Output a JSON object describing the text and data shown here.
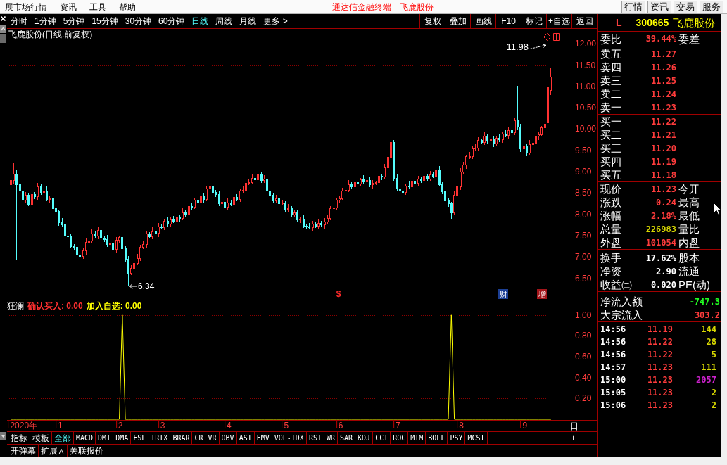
{
  "menu_bar": {
    "menus": [
      "展市场行情",
      "资讯",
      "工具",
      "帮助"
    ],
    "title": "通达信金融终端",
    "stock_name": "飞鹿股份",
    "buttons": [
      "行情",
      "资讯",
      "交易",
      "服务"
    ]
  },
  "period_tabs": [
    {
      "label": "分时",
      "selected": false
    },
    {
      "label": "1分钟",
      "selected": false
    },
    {
      "label": "5分钟",
      "selected": false
    },
    {
      "label": "15分钟",
      "selected": false
    },
    {
      "label": "30分钟",
      "selected": false
    },
    {
      "label": "60分钟",
      "selected": false
    },
    {
      "label": "日线",
      "selected": true
    },
    {
      "label": "周线",
      "selected": false
    },
    {
      "label": "月线",
      "selected": false
    },
    {
      "label": "更多 >",
      "selected": false
    }
  ],
  "toolbar_buttons": [
    "复权",
    "叠加",
    "画线",
    "F10",
    "标记",
    "+自选",
    "返回"
  ],
  "price_chart": {
    "title": "飞鹿股份(日线.前复权)",
    "high_label": "11.98",
    "low_label": "6.34",
    "event_marks": [
      {
        "label": "$",
        "kind": "symbol",
        "color": "#ff2a2a"
      },
      {
        "label": "财",
        "kind": "tag",
        "color": "#1c3f94"
      },
      {
        "label": "增",
        "kind": "tag",
        "color": "#a3151a"
      }
    ],
    "chart_data": {
      "type": "candlestick",
      "ylim": [
        6.0,
        12.35
      ],
      "grid": true,
      "yticks": [
        {
          "value": 12,
          "label": "12.00"
        },
        {
          "value": 11.5,
          "label": "11.50"
        },
        {
          "value": 11,
          "label": "11.00"
        },
        {
          "value": 10.5,
          "label": "10.50"
        },
        {
          "value": 10,
          "label": "10.00"
        },
        {
          "value": 9.5,
          "label": "9.50"
        },
        {
          "value": 9,
          "label": "9.00"
        },
        {
          "value": 8.5,
          "label": "8.50"
        },
        {
          "value": 8,
          "label": "8.00"
        },
        {
          "value": 7.5,
          "label": "7.50"
        },
        {
          "value": 7,
          "label": "7.00"
        },
        {
          "value": 6.5,
          "label": "6.50"
        }
      ],
      "categories": [
        null,
        null,
        null,
        null,
        null,
        null,
        null,
        null,
        null,
        null,
        null,
        null,
        null,
        null,
        null,
        null,
        null,
        null,
        null,
        null,
        null,
        null,
        null,
        null,
        null,
        null,
        null,
        null,
        null,
        null,
        null,
        null,
        null,
        null,
        null,
        null,
        null,
        null,
        null,
        null,
        null,
        null,
        null,
        null,
        null,
        null,
        null,
        null,
        null,
        null,
        null,
        null,
        null,
        null,
        null,
        null,
        null,
        null,
        null,
        null,
        null,
        null,
        null,
        null,
        null,
        null,
        null,
        null,
        null,
        null,
        null,
        null,
        null,
        null,
        null,
        null,
        null,
        null,
        null,
        null,
        null,
        null,
        null,
        null,
        null,
        null,
        null,
        null,
        null,
        null,
        null,
        null,
        null,
        null,
        null,
        null,
        null,
        null,
        null,
        null,
        null,
        null,
        null,
        null,
        null,
        null,
        null,
        null,
        null,
        null,
        null,
        null,
        null,
        null,
        null,
        null,
        null,
        null,
        null,
        null,
        null,
        null,
        null,
        null,
        null,
        null,
        null,
        null,
        null,
        null,
        null,
        null,
        null,
        null,
        null,
        null,
        null,
        null,
        null,
        null,
        null,
        null,
        null,
        null,
        null,
        null,
        null,
        null,
        null,
        null,
        null,
        null,
        null,
        null,
        null,
        null,
        null,
        null,
        null,
        null,
        null,
        null,
        null,
        null,
        null,
        null,
        null,
        null,
        null,
        null,
        null,
        null,
        null,
        null,
        null,
        null,
        null,
        null,
        null,
        null
      ],
      "ohlc": [
        [
          8.7,
          8.86,
          8.65,
          8.8
        ],
        [
          8.8,
          9.2,
          8.72,
          8.95
        ],
        [
          8.95,
          9.04,
          6.95,
          8.7
        ],
        [
          8.7,
          8.74,
          8.49,
          8.55
        ],
        [
          8.55,
          8.62,
          8.3,
          8.35
        ],
        [
          8.35,
          8.51,
          8.27,
          8.45
        ],
        [
          8.45,
          8.48,
          8.22,
          8.25
        ],
        [
          8.25,
          8.57,
          8.19,
          8.48
        ],
        [
          8.48,
          8.52,
          8.37,
          8.42
        ],
        [
          8.42,
          8.73,
          8.34,
          8.66
        ],
        [
          8.66,
          8.72,
          8.47,
          8.5
        ],
        [
          8.5,
          8.58,
          8.44,
          8.55
        ],
        [
          8.55,
          8.64,
          8.31,
          8.36
        ],
        [
          8.36,
          8.42,
          8.28,
          8.38
        ],
        [
          8.38,
          8.45,
          8.12,
          8.15
        ],
        [
          8.15,
          8.21,
          8.02,
          8.08
        ],
        [
          8.08,
          8.11,
          7.74,
          7.82
        ],
        [
          7.82,
          7.91,
          7.73,
          7.76
        ],
        [
          7.76,
          7.8,
          7.44,
          7.5
        ],
        [
          7.5,
          7.57,
          7.43,
          7.48
        ],
        [
          7.48,
          7.54,
          7.21,
          7.26
        ],
        [
          7.26,
          7.29,
          7.16,
          7.24
        ],
        [
          7.24,
          7.33,
          7.02,
          7.05
        ],
        [
          7.05,
          7.09,
          6.96,
          7.02
        ],
        [
          7.02,
          7.22,
          6.97,
          7.15
        ],
        [
          7.15,
          7.42,
          7.07,
          7.36
        ],
        [
          7.36,
          7.41,
          7.33,
          7.38
        ],
        [
          7.38,
          7.64,
          7.32,
          7.55
        ],
        [
          7.55,
          7.59,
          7.45,
          7.5
        ],
        [
          7.5,
          7.71,
          7.42,
          7.64
        ],
        [
          7.64,
          7.7,
          7.42,
          7.45
        ],
        [
          7.45,
          7.48,
          7.36,
          7.42
        ],
        [
          7.42,
          7.51,
          7.25,
          7.3
        ],
        [
          7.3,
          7.36,
          7.22,
          7.32
        ],
        [
          7.32,
          7.39,
          7.15,
          7.18
        ],
        [
          7.18,
          7.46,
          7.12,
          7.4
        ],
        [
          7.4,
          7.49,
          7.35,
          7.46
        ],
        [
          7.46,
          7.55,
          7.14,
          7.2
        ],
        [
          7.2,
          7.24,
          6.9,
          6.95
        ],
        [
          6.95,
          7.02,
          6.34,
          6.62
        ],
        [
          6.62,
          6.81,
          6.59,
          6.75
        ],
        [
          6.75,
          6.89,
          6.67,
          6.86
        ],
        [
          6.86,
          7.07,
          6.83,
          6.98
        ],
        [
          6.98,
          7.28,
          6.92,
          7.24
        ],
        [
          7.24,
          7.37,
          7.19,
          7.3
        ],
        [
          7.3,
          7.61,
          7.22,
          7.55
        ],
        [
          7.55,
          7.58,
          7.45,
          7.48
        ],
        [
          7.48,
          7.69,
          7.42,
          7.6
        ],
        [
          7.6,
          7.64,
          7.51,
          7.56
        ],
        [
          7.56,
          7.79,
          7.48,
          7.72
        ],
        [
          7.72,
          7.78,
          7.67,
          7.7
        ],
        [
          7.7,
          7.87,
          7.64,
          7.84
        ],
        [
          7.84,
          7.93,
          7.73,
          7.78
        ],
        [
          7.78,
          7.92,
          7.7,
          7.88
        ],
        [
          7.88,
          7.95,
          7.82,
          7.85
        ],
        [
          7.85,
          8.01,
          7.79,
          7.95
        ],
        [
          7.95,
          7.98,
          7.84,
          7.92
        ],
        [
          7.92,
          8.14,
          7.89,
          8.05
        ],
        [
          8.05,
          8.09,
          7.96,
          8.02
        ],
        [
          8.02,
          8.27,
          7.97,
          8.2
        ],
        [
          8.2,
          8.26,
          8.1,
          8.18
        ],
        [
          8.18,
          8.38,
          8.15,
          8.35
        ],
        [
          8.35,
          8.44,
          8.22,
          8.28
        ],
        [
          8.28,
          8.46,
          8.23,
          8.42
        ],
        [
          8.42,
          8.49,
          8.28,
          8.36
        ],
        [
          8.36,
          8.66,
          8.31,
          8.6
        ],
        [
          8.6,
          8.95,
          8.52,
          8.66
        ],
        [
          8.66,
          8.75,
          8.49,
          8.52
        ],
        [
          8.52,
          8.56,
          8.42,
          8.48
        ],
        [
          8.48,
          8.55,
          8.21,
          8.26
        ],
        [
          8.26,
          8.36,
          8.18,
          8.3
        ],
        [
          8.3,
          8.33,
          8.14,
          8.17
        ],
        [
          8.17,
          8.37,
          8.11,
          8.28
        ],
        [
          8.28,
          8.32,
          8.2,
          8.25
        ],
        [
          8.25,
          8.47,
          8.17,
          8.4
        ],
        [
          8.4,
          8.46,
          8.33,
          8.36
        ],
        [
          8.36,
          8.58,
          8.3,
          8.55
        ],
        [
          8.55,
          8.66,
          8.5,
          8.57
        ],
        [
          8.57,
          8.78,
          8.54,
          8.74
        ],
        [
          8.74,
          8.83,
          8.69,
          8.76
        ],
        [
          8.76,
          8.92,
          8.71,
          8.86
        ],
        [
          8.86,
          8.89,
          8.74,
          8.82
        ],
        [
          8.82,
          9.1,
          8.79,
          8.94
        ],
        [
          8.94,
          8.98,
          8.74,
          8.8
        ],
        [
          8.8,
          8.91,
          8.75,
          8.84
        ],
        [
          8.84,
          8.87,
          8.48,
          8.56
        ],
        [
          8.56,
          8.65,
          8.42,
          8.45
        ],
        [
          8.45,
          8.49,
          8.27,
          8.33
        ],
        [
          8.33,
          8.45,
          8.28,
          8.38
        ],
        [
          8.38,
          8.41,
          8.18,
          8.26
        ],
        [
          8.26,
          8.33,
          8.23,
          8.27
        ],
        [
          8.27,
          8.3,
          8.07,
          8.13
        ],
        [
          8.13,
          8.23,
          8.05,
          8.14
        ],
        [
          8.14,
          8.18,
          7.97,
          8.0
        ],
        [
          8.0,
          8.11,
          7.95,
          8.04
        ],
        [
          8.04,
          8.1,
          7.83,
          7.88
        ],
        [
          7.88,
          7.93,
          7.8,
          7.9
        ],
        [
          7.9,
          7.99,
          7.71,
          7.74
        ],
        [
          7.74,
          7.78,
          7.66,
          7.72
        ],
        [
          7.72,
          7.79,
          7.65,
          7.7
        ],
        [
          7.7,
          7.84,
          7.62,
          7.78
        ],
        [
          7.78,
          7.81,
          7.7,
          7.73
        ],
        [
          7.73,
          7.89,
          7.67,
          7.8
        ],
        [
          7.8,
          7.84,
          7.71,
          7.76
        ],
        [
          7.76,
          7.9,
          7.68,
          7.83
        ],
        [
          7.83,
          7.98,
          7.8,
          7.92
        ],
        [
          7.92,
          8.18,
          7.89,
          8.15
        ],
        [
          8.15,
          8.25,
          8.09,
          8.16
        ],
        [
          8.16,
          8.38,
          8.11,
          8.34
        ],
        [
          8.34,
          8.44,
          8.29,
          8.37
        ],
        [
          8.37,
          8.61,
          8.34,
          8.55
        ],
        [
          8.55,
          8.6,
          8.47,
          8.57
        ],
        [
          8.57,
          8.79,
          8.54,
          8.7
        ],
        [
          8.7,
          8.74,
          8.6,
          8.66
        ],
        [
          8.66,
          8.83,
          8.61,
          8.76
        ],
        [
          8.76,
          8.82,
          8.64,
          8.72
        ],
        [
          8.72,
          8.85,
          8.69,
          8.82
        ],
        [
          8.82,
          8.91,
          8.71,
          8.77
        ],
        [
          8.77,
          8.84,
          8.72,
          8.8
        ],
        [
          8.8,
          8.87,
          8.65,
          8.7
        ],
        [
          8.7,
          8.8,
          8.62,
          8.74
        ],
        [
          8.74,
          8.78,
          8.71,
          8.75
        ],
        [
          8.75,
          8.99,
          8.72,
          8.9
        ],
        [
          8.9,
          8.94,
          8.82,
          8.88
        ],
        [
          8.88,
          9.17,
          8.83,
          9.1
        ],
        [
          9.1,
          9.41,
          9.02,
          9.35
        ],
        [
          9.35,
          10.02,
          9.32,
          9.7
        ],
        [
          9.7,
          9.74,
          8.79,
          8.85
        ],
        [
          8.85,
          8.94,
          8.55,
          8.6
        ],
        [
          8.6,
          8.63,
          8.47,
          8.55
        ],
        [
          8.55,
          8.61,
          8.49,
          8.52
        ],
        [
          8.52,
          8.71,
          8.46,
          8.68
        ],
        [
          8.68,
          8.77,
          8.61,
          8.66
        ],
        [
          8.66,
          8.82,
          8.58,
          8.78
        ],
        [
          8.78,
          8.85,
          8.7,
          8.73
        ],
        [
          8.73,
          8.9,
          8.67,
          8.84
        ],
        [
          8.84,
          8.87,
          8.74,
          8.79
        ],
        [
          8.79,
          8.99,
          8.71,
          8.9
        ],
        [
          8.9,
          8.94,
          8.81,
          8.84
        ],
        [
          8.84,
          9.01,
          8.78,
          8.94
        ],
        [
          8.94,
          9.0,
          8.86,
          8.91
        ],
        [
          8.91,
          9.07,
          8.83,
          9.04
        ],
        [
          9.04,
          9.13,
          8.67,
          8.7
        ],
        [
          8.7,
          8.74,
          8.48,
          8.54
        ],
        [
          8.54,
          8.61,
          8.27,
          8.32
        ],
        [
          8.32,
          8.38,
          8.18,
          8.26
        ],
        [
          8.26,
          8.29,
          7.9,
          8.05
        ],
        [
          8.05,
          8.54,
          8.02,
          8.45
        ],
        [
          8.45,
          8.7,
          8.39,
          8.66
        ],
        [
          8.66,
          9.07,
          8.58,
          9.0
        ],
        [
          9.0,
          9.22,
          8.95,
          9.16
        ],
        [
          9.16,
          9.39,
          9.08,
          9.36
        ],
        [
          9.36,
          9.46,
          9.33,
          9.37
        ],
        [
          9.37,
          9.59,
          9.31,
          9.55
        ],
        [
          9.55,
          9.64,
          9.5,
          9.57
        ],
        [
          9.57,
          9.8,
          9.49,
          9.74
        ],
        [
          9.74,
          9.77,
          9.67,
          9.7
        ],
        [
          9.7,
          9.93,
          9.64,
          9.84
        ],
        [
          9.84,
          9.88,
          9.67,
          9.73
        ],
        [
          9.73,
          9.85,
          9.68,
          9.78
        ],
        [
          9.78,
          9.84,
          9.58,
          9.66
        ],
        [
          9.66,
          9.83,
          9.63,
          9.8
        ],
        [
          9.8,
          9.89,
          9.7,
          9.76
        ],
        [
          9.76,
          9.94,
          9.68,
          9.9
        ],
        [
          9.9,
          9.97,
          9.81,
          9.86
        ],
        [
          9.86,
          10.03,
          9.78,
          9.97
        ],
        [
          9.97,
          10.0,
          9.9,
          9.93
        ],
        [
          9.93,
          10.24,
          9.87,
          10.2
        ],
        [
          10.2,
          11.0,
          9.98,
          10.05
        ],
        [
          10.05,
          10.12,
          9.47,
          9.55
        ],
        [
          9.55,
          9.66,
          9.35,
          9.6
        ],
        [
          9.6,
          9.63,
          9.37,
          9.45
        ],
        [
          9.45,
          9.74,
          9.42,
          9.65
        ],
        [
          9.65,
          9.72,
          9.59,
          9.68
        ],
        [
          9.68,
          9.91,
          9.63,
          9.84
        ],
        [
          9.84,
          9.93,
          9.76,
          9.87
        ],
        [
          9.87,
          10.07,
          9.84,
          10.04
        ],
        [
          10.04,
          10.21,
          9.98,
          10.12
        ],
        [
          10.15,
          11.98,
          10.1,
          10.98
        ],
        [
          10.92,
          11.42,
          10.8,
          11.23
        ]
      ]
    }
  },
  "indicator": {
    "name": "狂澜",
    "legend": [
      {
        "label": "确认买入: 0.00",
        "color": "#ff3030"
      },
      {
        "label": "加入自选: 0.00",
        "color": "#ffff00"
      }
    ],
    "chart_data": {
      "type": "line",
      "ylim": [
        0,
        1.14
      ],
      "grid": true,
      "yticks": [
        {
          "value": 0.2,
          "label": "0.20"
        },
        {
          "value": 0.4,
          "label": "0.40"
        },
        {
          "value": 0.6,
          "label": "0.60"
        },
        {
          "value": 0.8,
          "label": "0.80"
        },
        {
          "value": 1,
          "label": "1.00"
        }
      ],
      "categories": [
        null,
        null,
        null,
        null,
        "2020年",
        null,
        null,
        null,
        null,
        null,
        null,
        null,
        null,
        null,
        null,
        null,
        "1",
        null,
        null,
        null,
        null,
        null,
        null,
        null,
        null,
        null,
        null,
        null,
        null,
        null,
        null,
        null,
        null,
        null,
        null,
        null,
        "2",
        null,
        null,
        null,
        null,
        null,
        null,
        null,
        null,
        null,
        null,
        null,
        null,
        null,
        "3",
        null,
        null,
        null,
        null,
        null,
        null,
        null,
        null,
        null,
        null,
        null,
        null,
        null,
        null,
        null,
        null,
        null,
        null,
        null,
        null,
        null,
        "4",
        null,
        null,
        null,
        null,
        null,
        null,
        null,
        null,
        null,
        null,
        null,
        null,
        null,
        null,
        null,
        null,
        null,
        null,
        "5",
        null,
        null,
        null,
        null,
        null,
        null,
        null,
        null,
        null,
        null,
        null,
        null,
        null,
        null,
        null,
        null,
        null,
        "6",
        null,
        null,
        null,
        null,
        null,
        null,
        null,
        null,
        null,
        null,
        null,
        null,
        null,
        null,
        null,
        null,
        null,
        null,
        "7",
        null,
        null,
        null,
        null,
        null,
        null,
        null,
        null,
        null,
        null,
        null,
        null,
        null,
        null,
        null,
        null,
        null,
        null,
        null,
        null,
        "8",
        null,
        null,
        null,
        null,
        null,
        null,
        null,
        null,
        null,
        null,
        null,
        null,
        null,
        null,
        null,
        null,
        null,
        null,
        null,
        null,
        "9",
        null,
        null,
        null,
        null,
        null,
        null,
        null,
        null,
        null
      ],
      "series": [
        {
          "color": "#ffff00",
          "values": [
            0,
            0,
            0,
            0,
            0,
            0,
            0,
            0,
            0,
            0,
            0,
            0,
            0,
            0,
            0,
            0,
            0,
            0,
            0,
            0,
            0,
            0,
            0,
            0,
            0,
            0,
            0,
            0,
            0,
            0,
            0,
            0,
            0,
            0,
            0,
            0,
            0,
            1,
            0,
            0,
            0,
            0,
            0,
            0,
            0,
            0,
            0,
            0,
            0,
            0,
            0,
            0,
            0,
            0,
            0,
            0,
            0,
            0,
            0,
            0,
            0,
            0,
            0,
            0,
            0,
            0,
            0,
            0,
            0,
            0,
            0,
            0,
            0,
            0,
            0,
            0,
            0,
            0,
            0,
            0,
            0,
            0,
            0,
            0,
            0,
            0,
            0,
            0,
            0,
            0,
            0,
            0,
            0,
            0,
            0,
            0,
            0,
            0,
            0,
            0,
            0,
            0,
            0,
            0,
            0,
            0,
            0,
            0,
            0,
            0,
            0,
            0,
            0,
            0,
            0,
            0,
            0,
            0,
            0,
            0,
            0,
            0,
            0,
            0,
            0,
            0,
            0,
            0,
            0,
            0,
            0,
            0,
            0,
            0,
            0,
            0,
            0,
            0,
            0,
            0,
            0,
            0,
            0,
            0,
            0,
            0,
            1,
            0,
            0,
            0,
            0,
            0,
            0,
            0,
            0,
            0,
            0,
            0,
            0,
            0,
            0,
            0,
            0,
            0,
            0,
            0,
            0,
            0,
            0,
            0,
            0,
            0,
            0,
            0,
            0,
            0,
            0,
            0,
            0,
            0
          ]
        }
      ]
    }
  },
  "period_button": "日",
  "indicator_tabs": [
    {
      "label": "指标",
      "selected": false
    },
    {
      "label": "模板",
      "selected": false
    },
    {
      "label": "全部",
      "selected": true
    },
    {
      "label": "MACD",
      "selected": false
    },
    {
      "label": "DMI",
      "selected": false
    },
    {
      "label": "DMA",
      "selected": false
    },
    {
      "label": "FSL",
      "selected": false
    },
    {
      "label": "TRIX",
      "selected": false
    },
    {
      "label": "BRAR",
      "selected": false
    },
    {
      "label": "CR",
      "selected": false
    },
    {
      "label": "VR",
      "selected": false
    },
    {
      "label": "OBV",
      "selected": false
    },
    {
      "label": "ASI",
      "selected": false
    },
    {
      "label": "EMV",
      "selected": false
    },
    {
      "label": "VOL-TDX",
      "selected": false
    },
    {
      "label": "RSI",
      "selected": false
    },
    {
      "label": "WR",
      "selected": false
    },
    {
      "label": "SAR",
      "selected": false
    },
    {
      "label": "KDJ",
      "selected": false
    },
    {
      "label": "CCI",
      "selected": false
    },
    {
      "label": "ROC",
      "selected": false
    },
    {
      "label": "MTM",
      "selected": false
    },
    {
      "label": "BOLL",
      "selected": false
    },
    {
      "label": "PSY",
      "selected": false
    },
    {
      "label": "MCST",
      "selected": false
    }
  ],
  "add_button": "+",
  "bottom_buttons": [
    "开弹幕",
    "扩展∧",
    "关联报价"
  ],
  "quote_panel": {
    "market": "L",
    "code": "300665",
    "name": "飞鹿股份",
    "order_ratio": {
      "label": "委比",
      "value": "39.44%",
      "label_2": "委差"
    },
    "asks": [
      {
        "label": "卖五",
        "price": "11.27"
      },
      {
        "label": "卖四",
        "price": "11.26"
      },
      {
        "label": "卖三",
        "price": "11.25"
      },
      {
        "label": "卖二",
        "price": "11.24"
      },
      {
        "label": "卖一",
        "price": "11.23"
      }
    ],
    "bids": [
      {
        "label": "买一",
        "price": "11.22"
      },
      {
        "label": "买二",
        "price": "11.21"
      },
      {
        "label": "买三",
        "price": "11.20"
      },
      {
        "label": "买四",
        "price": "11.19"
      },
      {
        "label": "买五",
        "price": "11.18"
      }
    ],
    "stats": [
      {
        "label": "现价",
        "value": "11.23",
        "color": "#ff3c3c",
        "label_2": "今开"
      },
      {
        "label": "涨跌",
        "value": "0.24",
        "color": "#ff3c3c",
        "label_2": "最高"
      },
      {
        "label": "涨幅",
        "value": "2.18%",
        "color": "#ff3c3c",
        "label_2": "最低"
      },
      {
        "label": "总量",
        "value": "226983",
        "color": "#d6d600",
        "label_2": "量比"
      },
      {
        "label": "外盘",
        "value": "101054",
        "color": "#ff3c3c",
        "label_2": "内盘"
      }
    ],
    "fundamentals": [
      {
        "label": "换手",
        "value": "17.62%",
        "label_2": "股本"
      },
      {
        "label": "净资",
        "value": "2.90",
        "label_2": "流通"
      },
      {
        "label": "收益㈡",
        "value": "0.020",
        "label_2": "PE(动)"
      }
    ],
    "flows": [
      {
        "label": "净流入额",
        "value": "-747.3",
        "color": "#22ff22"
      },
      {
        "label": "大宗流入",
        "value": "303.2",
        "color": "#ff3c3c"
      }
    ],
    "trades": [
      {
        "time": "14:56",
        "price": "11.19",
        "volume": "144",
        "color": "#d6d600"
      },
      {
        "time": "14:56",
        "price": "11.22",
        "volume": "28",
        "color": "#d6d600"
      },
      {
        "time": "14:56",
        "price": "11.22",
        "volume": "5",
        "color": "#d6d600"
      },
      {
        "time": "14:57",
        "price": "11.23",
        "volume": "111",
        "color": "#d6d600"
      },
      {
        "time": "15:00",
        "price": "11.23",
        "volume": "2057",
        "color": "#cc22cc"
      },
      {
        "time": "15:05",
        "price": "11.23",
        "volume": "2",
        "color": "#d6d600"
      },
      {
        "time": "15:06",
        "price": "11.23",
        "volume": "2",
        "color": "#d6d600"
      }
    ]
  }
}
